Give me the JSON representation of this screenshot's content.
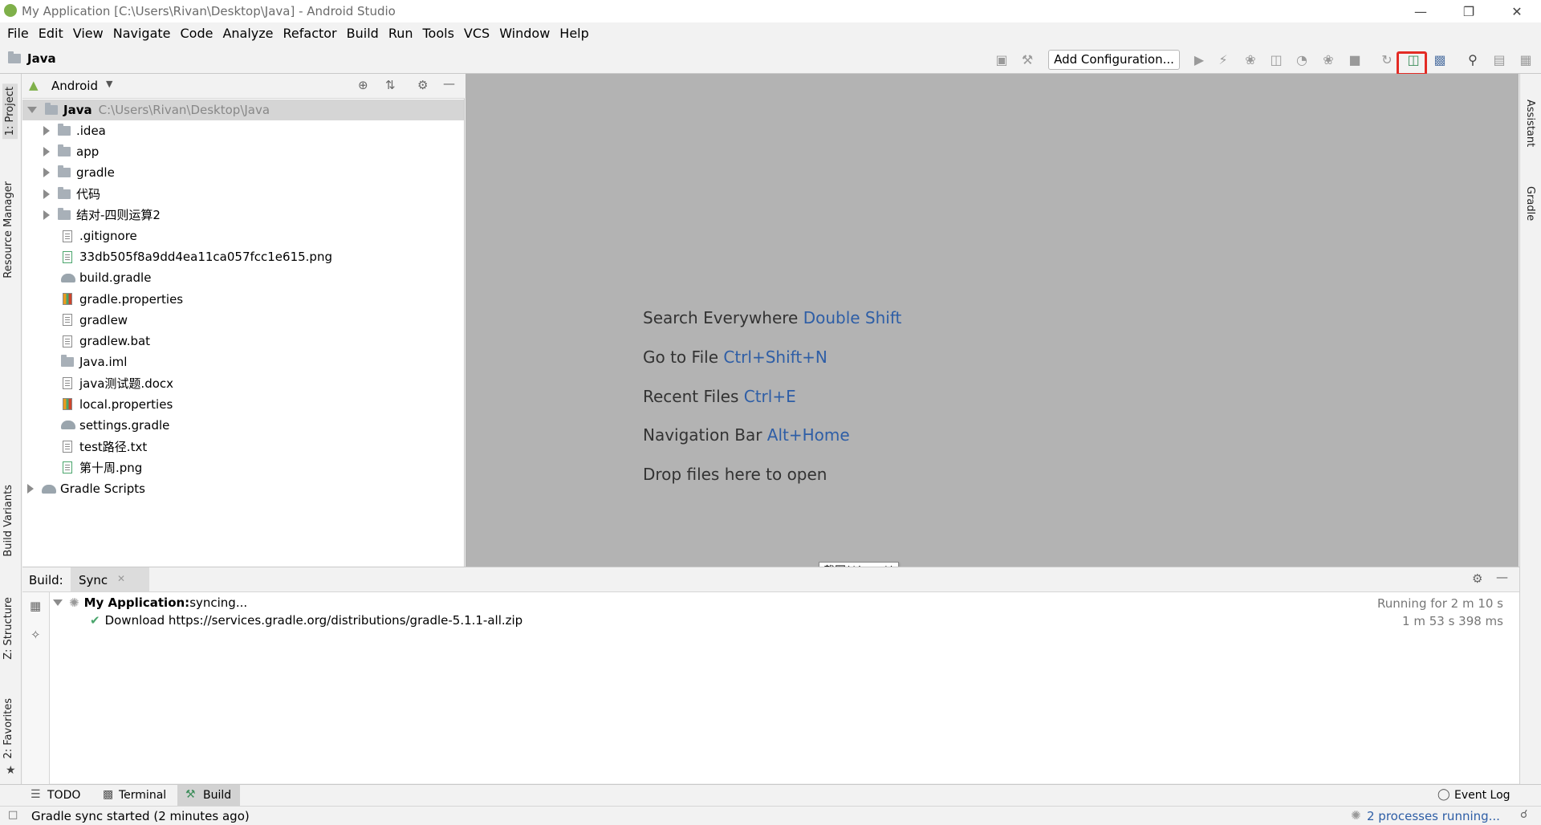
{
  "window": {
    "title": "My Application [C:\\Users\\Rivan\\Desktop\\Java] - Android Studio"
  },
  "menu": [
    "File",
    "Edit",
    "View",
    "Navigate",
    "Code",
    "Analyze",
    "Refactor",
    "Build",
    "Run",
    "Tools",
    "VCS",
    "Window",
    "Help"
  ],
  "navbar": {
    "crumb": "Java",
    "add_config": "Add Configuration..."
  },
  "left_tabs": {
    "project": "1: Project",
    "resource_manager": "Resource Manager",
    "build_variants": "Build Variants",
    "structure": "Z: Structure",
    "favorites": "2: Favorites"
  },
  "right_tabs": {
    "assistant": "Assistant",
    "gradle": "Gradle"
  },
  "project": {
    "view_mode": "Android",
    "root": {
      "name": "Java",
      "path": "C:\\Users\\Rivan\\Desktop\\Java"
    },
    "items": [
      {
        "name": ".idea",
        "kind": "folder"
      },
      {
        "name": "app",
        "kind": "folder"
      },
      {
        "name": "gradle",
        "kind": "folder"
      },
      {
        "name": "代码",
        "kind": "folder"
      },
      {
        "name": "结对-四则运算2",
        "kind": "folder"
      },
      {
        "name": ".gitignore",
        "kind": "file"
      },
      {
        "name": "33db505f8a9dd4ea11ca057fcc1e615.png",
        "kind": "image"
      },
      {
        "name": "build.gradle",
        "kind": "gradle"
      },
      {
        "name": "gradle.properties",
        "kind": "props"
      },
      {
        "name": "gradlew",
        "kind": "file"
      },
      {
        "name": "gradlew.bat",
        "kind": "file"
      },
      {
        "name": "Java.iml",
        "kind": "iml"
      },
      {
        "name": "java测试题.docx",
        "kind": "file"
      },
      {
        "name": "local.properties",
        "kind": "props"
      },
      {
        "name": "settings.gradle",
        "kind": "gradle"
      },
      {
        "name": "test路径.txt",
        "kind": "file"
      },
      {
        "name": "第十周.png",
        "kind": "image"
      }
    ],
    "gradle_scripts": "Gradle Scripts"
  },
  "editor_hints": [
    {
      "text": "Search Everywhere ",
      "key": "Double Shift"
    },
    {
      "text": "Go to File ",
      "key": "Ctrl+Shift+N"
    },
    {
      "text": "Recent Files ",
      "key": "Ctrl+E"
    },
    {
      "text": "Navigation Bar ",
      "key": "Alt+Home"
    },
    {
      "text": "Drop files here to open",
      "key": ""
    }
  ],
  "tooltip": "截图(Alt + A)",
  "build": {
    "label": "Build:",
    "tab": "Sync",
    "row1": {
      "app": "My Application:",
      "status": " syncing...",
      "time": "Running for 2 m 10 s"
    },
    "row2": {
      "text": "Download https://services.gradle.org/distributions/gradle-5.1.1-all.zip",
      "time": "1 m 53 s 398 ms"
    }
  },
  "bottom_tabs": {
    "todo": "TODO",
    "terminal": "Terminal",
    "build": "Build",
    "event_log": "Event Log"
  },
  "status": {
    "message": "Gradle sync started (2 minutes ago)",
    "processes": "2 processes running..."
  },
  "colors": {
    "highlight": "#e32b25",
    "link": "#2e5ea6",
    "check": "#4aa56c"
  }
}
